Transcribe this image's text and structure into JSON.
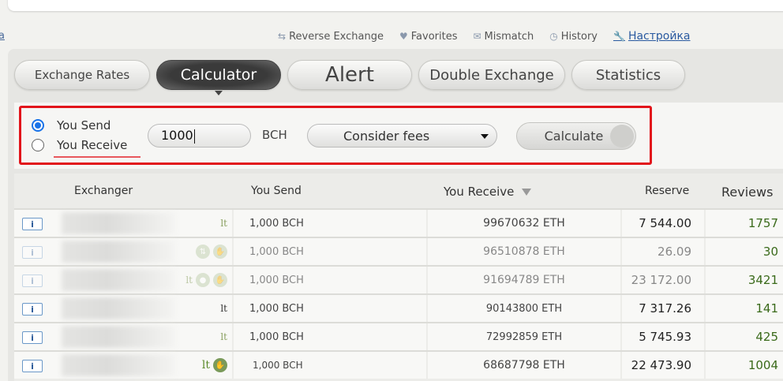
{
  "edge_mark": "a",
  "toolbar": {
    "items": [
      {
        "icon": "reverse-arrows-icon",
        "label": "Reverse Exchange"
      },
      {
        "icon": "heart-icon",
        "label": "Favorites"
      },
      {
        "icon": "mail-icon",
        "label": "Mismatch"
      },
      {
        "icon": "history-icon",
        "label": "History"
      },
      {
        "icon": "wrench-icon",
        "label": "Настройка"
      }
    ]
  },
  "tabs": [
    {
      "label": "Exchange Rates",
      "active": false
    },
    {
      "label": "Calculator",
      "active": true
    },
    {
      "label": "Alert",
      "active": false
    },
    {
      "label": "Double Exchange",
      "active": false
    },
    {
      "label": "Statistics",
      "active": false
    }
  ],
  "calculator": {
    "radio_send": "You Send",
    "radio_receive": "You Receive",
    "selected": "You Send",
    "amount": "1000",
    "currency": "BCH",
    "fees_option": "Consider fees",
    "calculate_label": "Calculate"
  },
  "table": {
    "headers": {
      "exchanger": "Exchanger",
      "send": "You Send",
      "receive": "You Receive",
      "reserve": "Reserve",
      "reviews": "Reviews"
    },
    "rows": [
      {
        "send": "1,000 BCH",
        "receive": "99670632 ETH",
        "reserve": "7 544.00",
        "reviews": "1757",
        "badges": "lt"
      },
      {
        "send": "1,000 BCH",
        "receive": "96510878 ETH",
        "reserve": "26.09",
        "reviews": "30",
        "badges": "arrows-hand"
      },
      {
        "send": "1,000 BCH",
        "receive": "91694789 ETH",
        "reserve": "23 172.00",
        "reviews": "3421",
        "badges": "lt-person-hand"
      },
      {
        "send": "1,000 BCH",
        "receive": "90143800 ETH",
        "reserve": "7 317.26",
        "reviews": "141",
        "badges": "lt"
      },
      {
        "send": "1,000 BCH",
        "receive": "72992859 ETH",
        "reserve": "5 745.93",
        "reviews": "425",
        "badges": "lt"
      },
      {
        "send": "1,000 BCH",
        "receive": "68687798 ETH",
        "reserve": "22 473.90",
        "reviews": "1004",
        "badges": "lt-hand"
      }
    ],
    "badge_text": "lt"
  }
}
